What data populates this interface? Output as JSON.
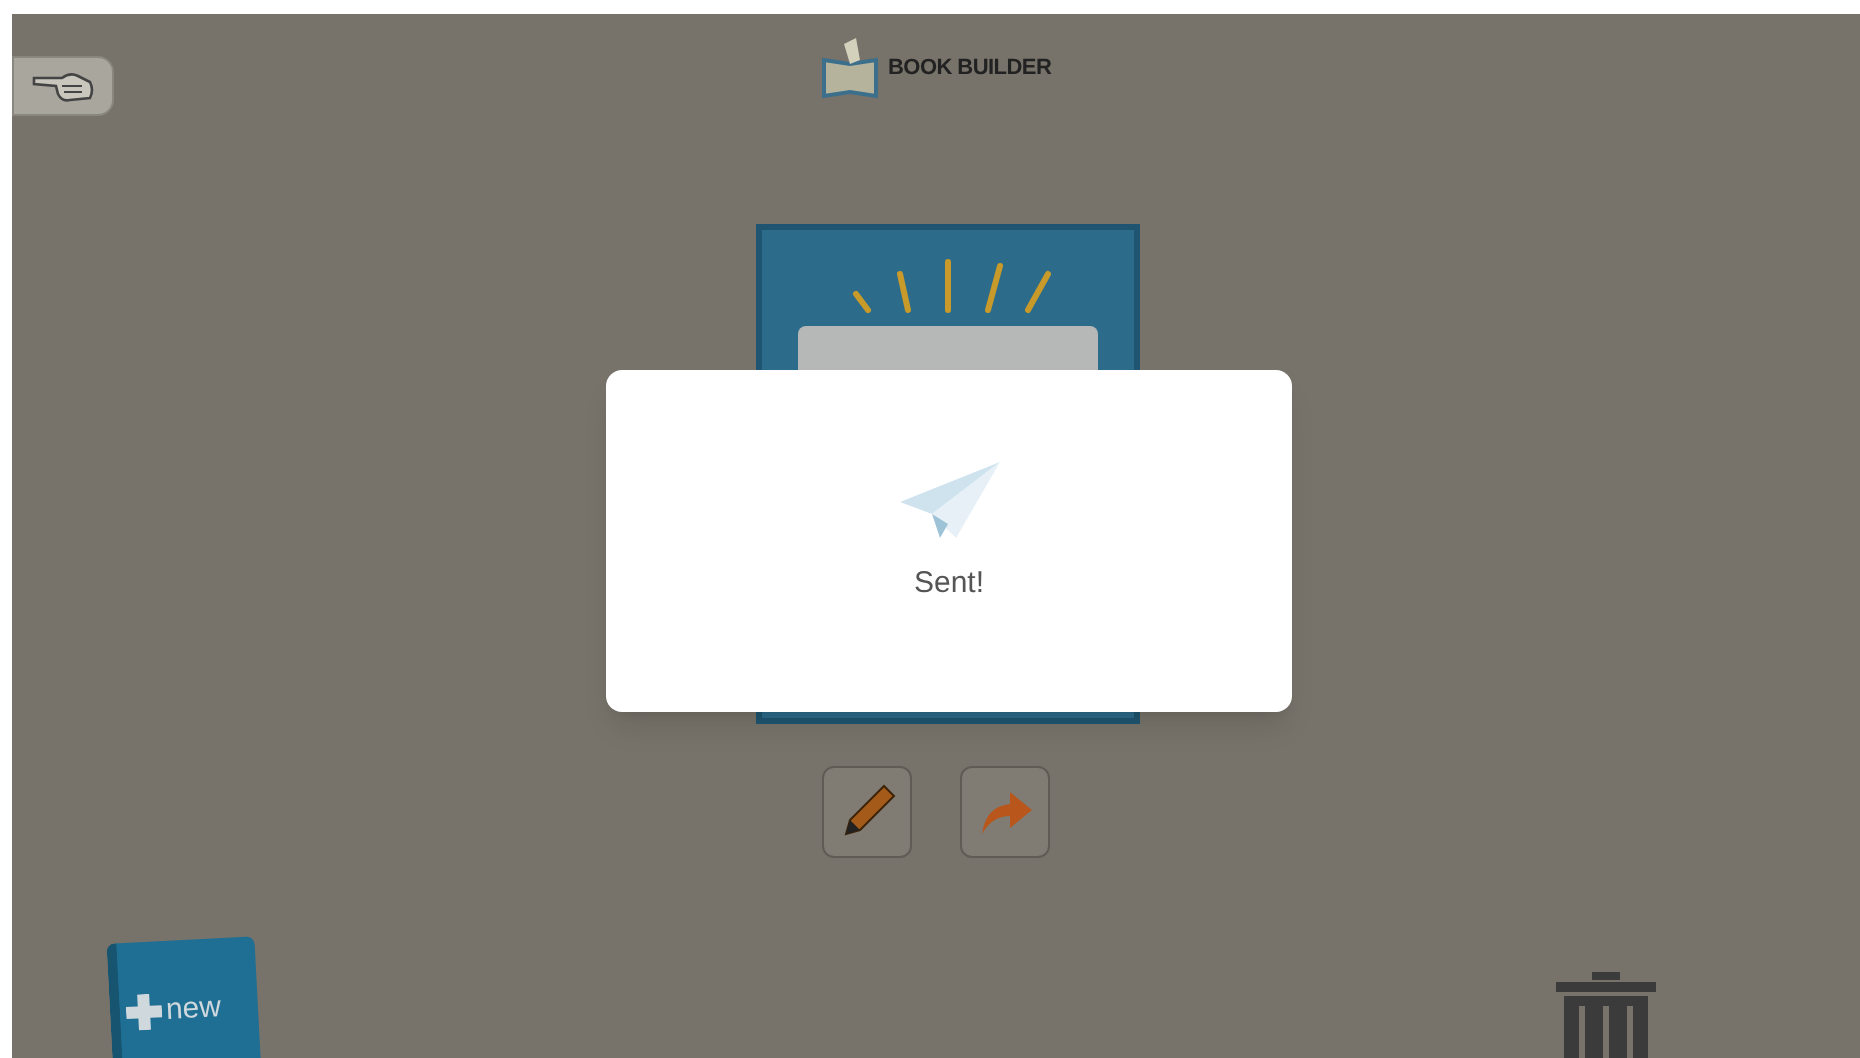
{
  "header": {
    "title": "BOOK BUILDER"
  },
  "new_book": {
    "label": "new"
  },
  "dialog": {
    "message": "Sent!"
  }
}
